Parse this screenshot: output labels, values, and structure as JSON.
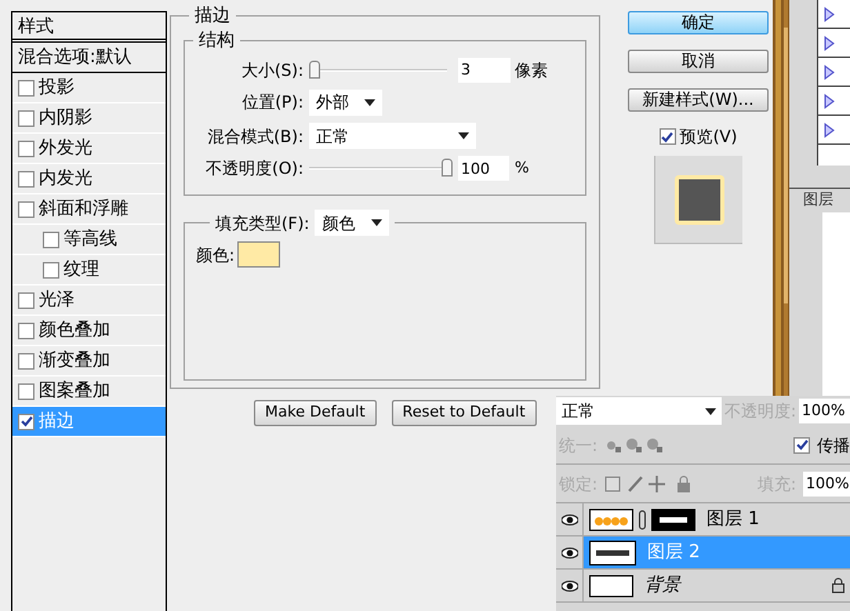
{
  "styles_panel": {
    "header": "样式",
    "blending_options": "混合选项:默认",
    "items": [
      {
        "label": "投影",
        "checked": false,
        "selected": false
      },
      {
        "label": "内阴影",
        "checked": false,
        "selected": false
      },
      {
        "label": "外发光",
        "checked": false,
        "selected": false
      },
      {
        "label": "内发光",
        "checked": false,
        "selected": false
      },
      {
        "label": "斜面和浮雕",
        "checked": false,
        "selected": false,
        "children": [
          {
            "label": "等高线",
            "checked": false,
            "selected": false
          },
          {
            "label": "纹理",
            "checked": false,
            "selected": false
          }
        ]
      },
      {
        "label": "光泽",
        "checked": false,
        "selected": false
      },
      {
        "label": "颜色叠加",
        "checked": false,
        "selected": false
      },
      {
        "label": "渐变叠加",
        "checked": false,
        "selected": false
      },
      {
        "label": "图案叠加",
        "checked": false,
        "selected": false
      },
      {
        "label": "描边",
        "checked": true,
        "selected": true
      }
    ]
  },
  "stroke": {
    "title": "描边",
    "structure": {
      "title": "结构",
      "size": {
        "label": "大小(S):",
        "level": 0,
        "value": "3",
        "unit": "像素"
      },
      "position": {
        "label": "位置(P):",
        "value": "外部"
      },
      "blend_mode": {
        "label": "混合模式(B):",
        "value": "正常"
      },
      "opacity": {
        "label": "不透明度(O):",
        "level": 1,
        "value": "100",
        "unit": "%"
      }
    },
    "fill": {
      "type_label": "填充类型(F):",
      "type_value": "颜色",
      "color_label": "颜色:",
      "color": "#ffeaa5"
    },
    "buttons": [
      {
        "label": "Make Default"
      },
      {
        "label": "Reset to Default"
      }
    ]
  },
  "actions": [
    {
      "label": "确定",
      "default": true
    },
    {
      "label": "取消",
      "default": false
    },
    {
      "label": "新建样式(W)...",
      "default": false
    }
  ],
  "preview": {
    "label": "预览(V)",
    "checked": true
  },
  "background_panel": {
    "tab": "图层"
  },
  "layers_panel": {
    "blend_mode": "正常",
    "opacity": {
      "label": "不透明度:",
      "value": "100%",
      "disabled": true
    },
    "unify": {
      "label": "统一:",
      "disabled": true
    },
    "propagate": {
      "label": "传播",
      "checked": true
    },
    "lock": {
      "label": "锁定:",
      "disabled": true
    },
    "fill": {
      "label": "填充:",
      "value": "100%",
      "disabled": true
    },
    "layers": [
      {
        "name": "图层 1",
        "kind": "masked",
        "visible": true,
        "selected": false,
        "locked": false
      },
      {
        "name": "图层 2",
        "kind": "text",
        "visible": true,
        "selected": true,
        "locked": false
      },
      {
        "name": "背景",
        "kind": "background",
        "visible": true,
        "selected": false,
        "locked": true
      }
    ]
  }
}
